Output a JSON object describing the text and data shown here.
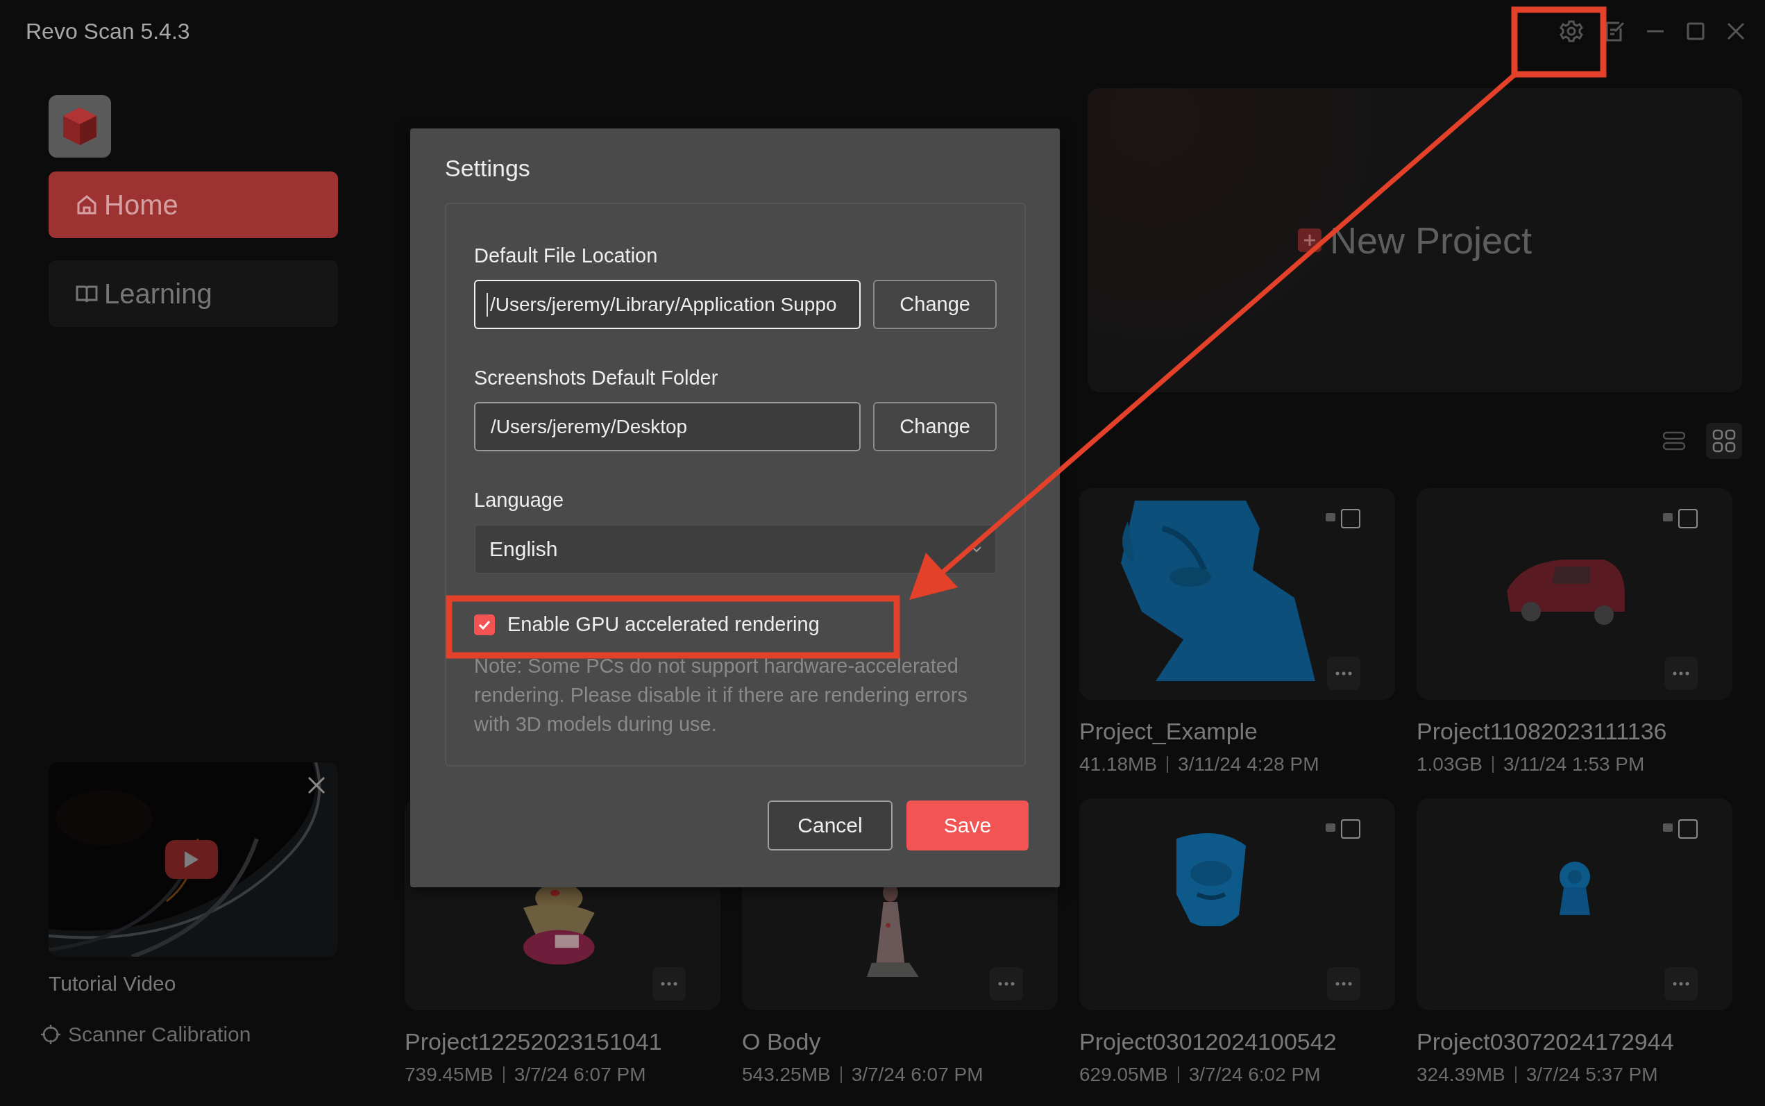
{
  "window": {
    "title": "Revo Scan 5.4.3"
  },
  "sidebar": {
    "nav": [
      {
        "kind": "home",
        "label": "Home",
        "selected": true
      },
      {
        "kind": "learning",
        "label": "Learning",
        "selected": false
      }
    ],
    "tutorial": {
      "caption": "Tutorial Video"
    },
    "calibration": "Scanner Calibration"
  },
  "new_project": {
    "label": "New Project"
  },
  "view_modes": [
    {
      "kind": "list",
      "selected": false
    },
    {
      "kind": "grid",
      "selected": true
    }
  ],
  "projects": [
    {
      "name": "Project_Example",
      "size": "41.18MB",
      "date": "3/11/24 4:28 PM",
      "checked": false
    },
    {
      "name": "Project11082023111136",
      "size": "1.03GB",
      "date": "3/11/24 1:53 PM",
      "checked": false
    },
    {
      "name": "Project12252023151041",
      "size": "739.45MB",
      "date": "3/7/24 6:07 PM"
    },
    {
      "name": "O Body",
      "size": "543.25MB",
      "date": "3/7/24 6:07 PM"
    },
    {
      "name": "Project03012024100542",
      "size": "629.05MB",
      "date": "3/7/24 6:02 PM",
      "checked": false
    },
    {
      "name": "Project03072024172944",
      "size": "324.39MB",
      "date": "3/7/24 5:37 PM",
      "checked": false
    }
  ],
  "settings": {
    "title": "Settings",
    "fields": [
      {
        "label": "Default File Location",
        "value": "/Users/jeremy/Library/Application Suppo",
        "focused": true,
        "button": "Change"
      },
      {
        "label": "Screenshots Default Folder",
        "value": "/Users/jeremy/Desktop",
        "focused": false,
        "button": "Change"
      }
    ],
    "language": {
      "label": "Language",
      "value": "English"
    },
    "gpu": {
      "label": "Enable GPU accelerated rendering",
      "checked": true
    },
    "note": "Note: Some PCs do not support hardware-accelerated rendering. Please disable it if there are rendering errors with 3D models during use.",
    "buttons": [
      {
        "label": "Cancel",
        "kind": "secondary"
      },
      {
        "label": "Save",
        "kind": "primary"
      }
    ]
  }
}
